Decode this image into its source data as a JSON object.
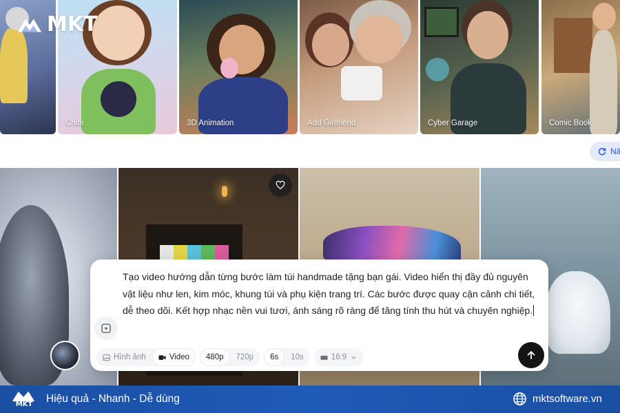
{
  "brand": {
    "name": "MKT"
  },
  "styles": [
    {
      "label": ""
    },
    {
      "label": "Chibi"
    },
    {
      "label": "3D Animation"
    },
    {
      "label": "Add Girlfriend"
    },
    {
      "label": "Cyber Garage"
    },
    {
      "label": "Comic Book"
    }
  ],
  "refresh": {
    "label": "Nă"
  },
  "prompt": {
    "text": "Tạo video hướng dẫn từng bước làm túi handmade tặng bạn gái. Video hiển thị đầy đủ nguyên vật liệu như len, kim móc, khung túi và phụ kiện trang trí. Các bước được quay cận cảnh chi tiết, dễ theo dõi. Kết hợp nhạc nền vui tươi, ánh sáng rõ ràng để tăng tính thu hút và chuyên nghiệp."
  },
  "toolbar": {
    "image_label": "Hình ảnh",
    "video_label": "Video",
    "res_480": "480p",
    "res_720": "720p",
    "dur_6": "6s",
    "dur_10": "10s",
    "ratio": "16:9"
  },
  "footer": {
    "logo_text": "MKT",
    "tagline": "Hiệu quả - Nhanh - Dễ dùng",
    "site": "mktsoftware.vn"
  },
  "colors": {
    "accent": "#2b55d8",
    "footer": "#1f5bb8",
    "send": "#141414"
  }
}
